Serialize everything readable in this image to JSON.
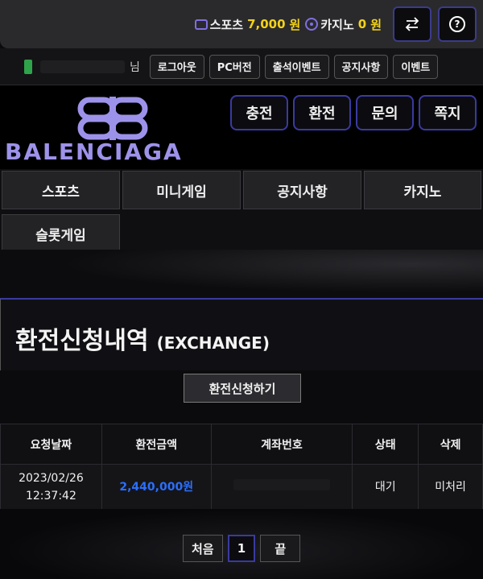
{
  "balance": {
    "sports_label": "스포츠",
    "sports_amount": "7,000",
    "sports_unit": "원",
    "casino_label": "카지노",
    "casino_amount": "0",
    "casino_unit": "원"
  },
  "icons": {
    "transfer": "transfer-arrows-icon",
    "help": "question-icon",
    "wallet": "wallet-icon",
    "casino": "casino-chip-icon"
  },
  "user": {
    "honorific": "님",
    "buttons": [
      "로그아웃",
      "PC버전",
      "출석이벤트",
      "공지사항",
      "이벤트"
    ]
  },
  "brand": {
    "logo_text": "BALENCIAGA"
  },
  "header_buttons": [
    "충전",
    "환전",
    "문의",
    "쪽지"
  ],
  "nav": [
    "스포츠",
    "미니게임",
    "공지사항",
    "카지노",
    "슬롯게임"
  ],
  "exchange": {
    "title": "환전신청내역",
    "title_en": "(EXCHANGE)",
    "request_button": "환전신청하기"
  },
  "table": {
    "headers": [
      "요청날짜",
      "환전금액",
      "계좌번호",
      "상태",
      "삭제"
    ],
    "rows": [
      {
        "date": "2023/02/26",
        "time": "12:37:42",
        "amount": "2,440,000원",
        "account": "",
        "status": "대기",
        "action": "미처리"
      }
    ]
  },
  "pagination": {
    "first": "처음",
    "current": "1",
    "last": "끝"
  },
  "colors": {
    "accent": "#3a3aa0",
    "balance": "#f2d21a",
    "logo": "#9d92ea",
    "amount": "#2a6fff"
  }
}
